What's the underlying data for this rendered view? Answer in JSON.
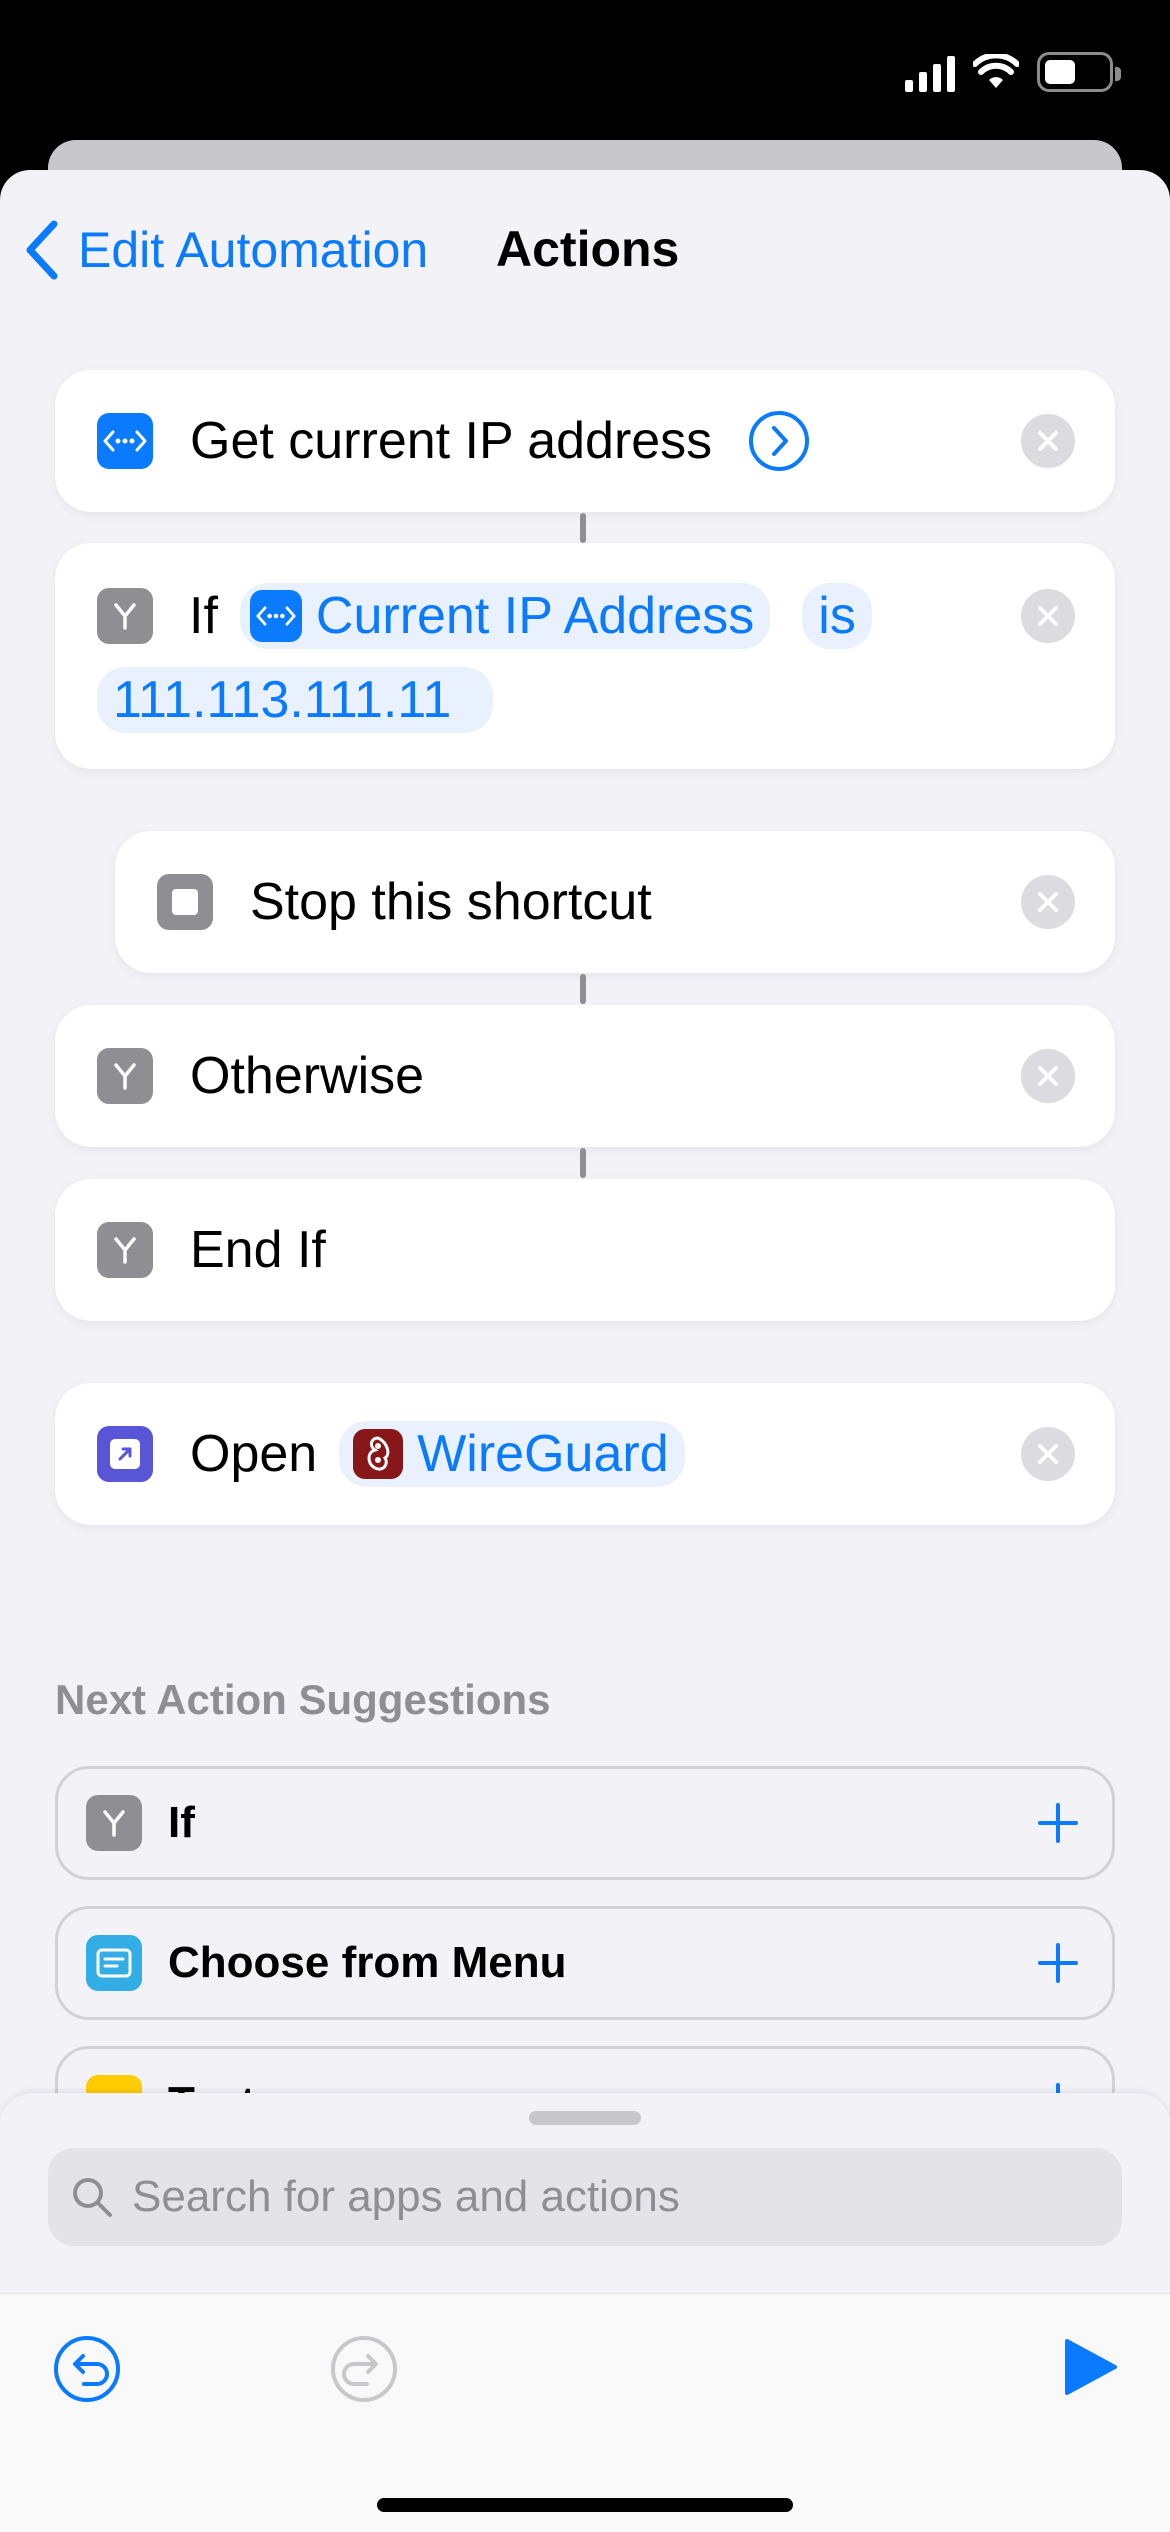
{
  "nav": {
    "back_label": "Edit Automation",
    "title": "Actions"
  },
  "actions": {
    "get_ip": {
      "label": "Get current IP address"
    },
    "if": {
      "label": "If",
      "variable": "Current IP Address",
      "operator": "is",
      "value": "111.113.111.11"
    },
    "stop": {
      "label": "Stop this shortcut"
    },
    "otherwise": {
      "label": "Otherwise"
    },
    "end_if": {
      "label": "End If"
    },
    "open": {
      "label": "Open",
      "app": "WireGuard"
    }
  },
  "suggestions": {
    "title": "Next Action Suggestions",
    "items": [
      {
        "label": "If",
        "icon": "if-icon"
      },
      {
        "label": "Choose from Menu",
        "icon": "menu-icon"
      },
      {
        "label": "Text",
        "icon": "text-icon"
      }
    ]
  },
  "search": {
    "placeholder": "Search for apps and actions"
  },
  "colors": {
    "accent": "#0a7aff",
    "network": "#0a7aff",
    "scripting": "#8e8e93",
    "open_app": "#5856d6",
    "wireguard": "#88171a",
    "menu": "#32ade6",
    "text": "#ffcc00"
  }
}
